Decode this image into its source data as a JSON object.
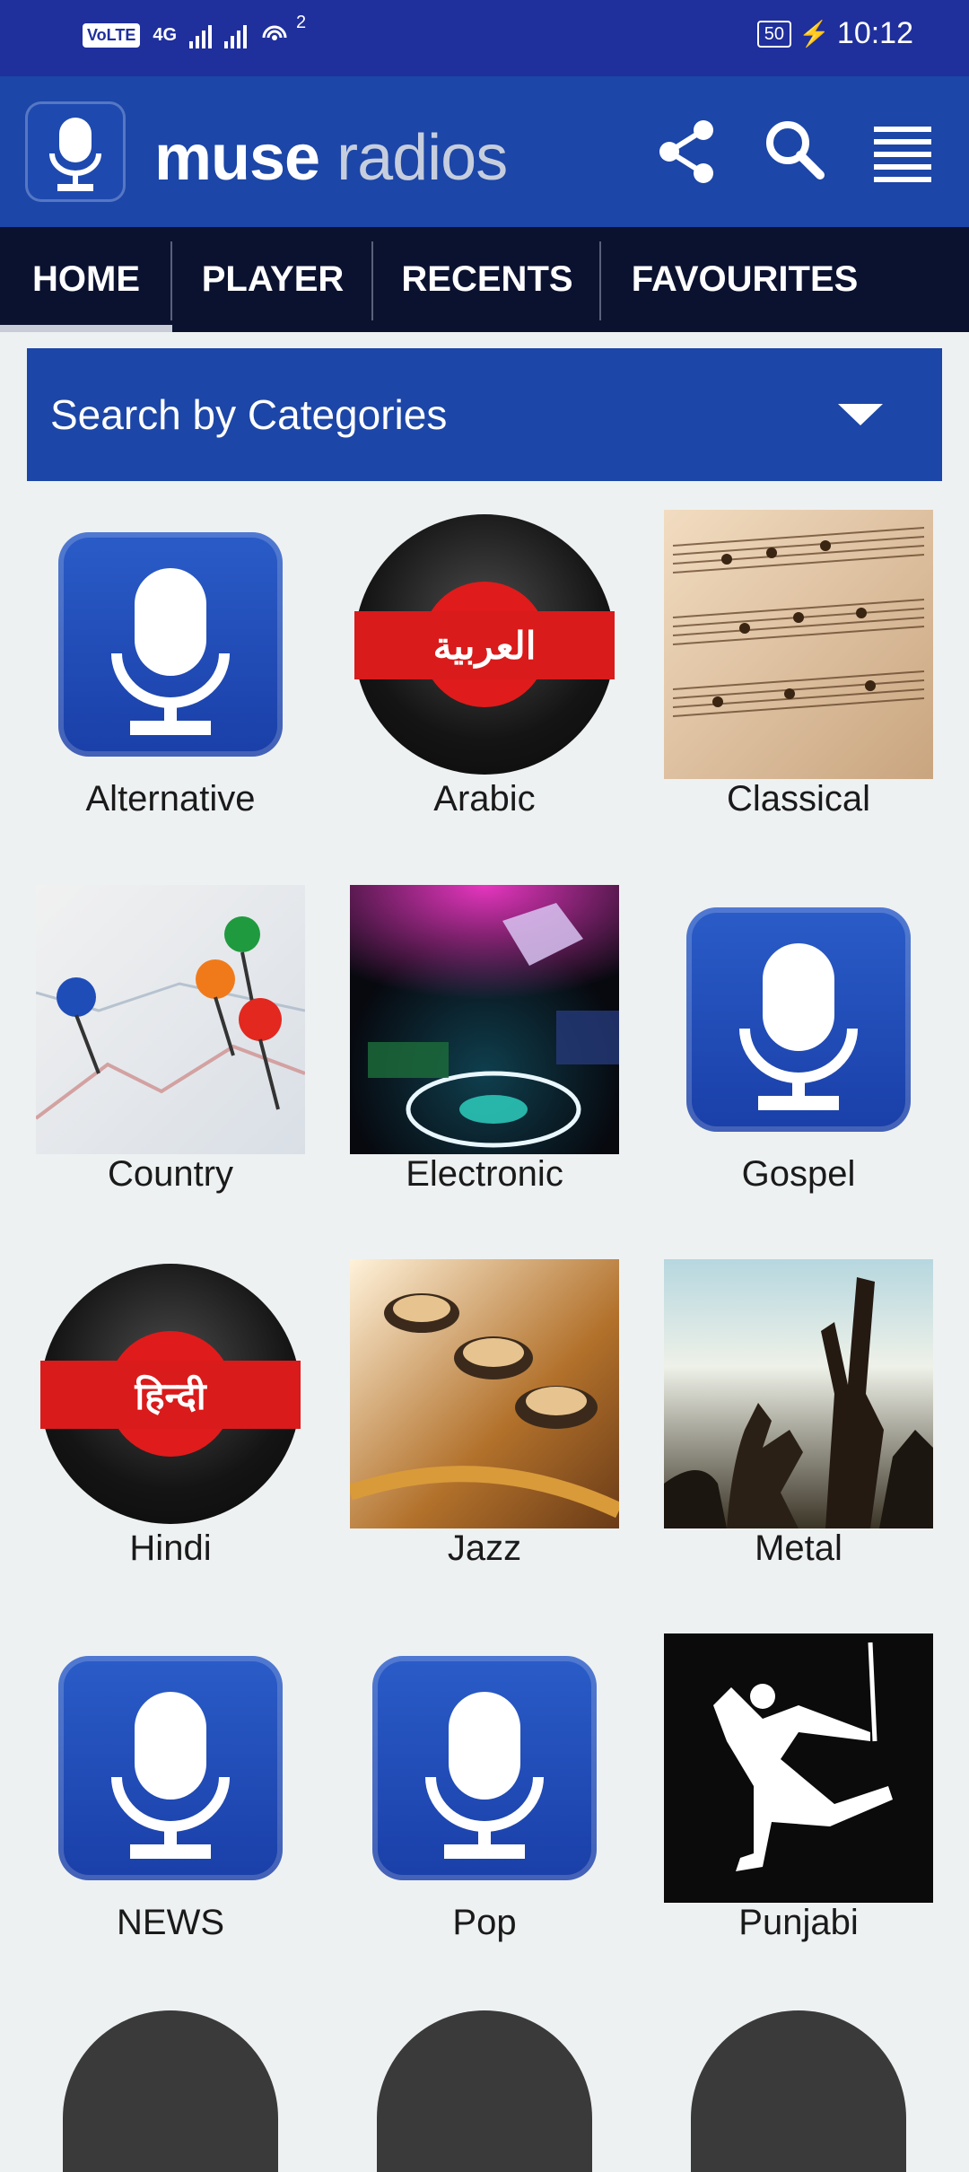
{
  "status": {
    "volte": "VoLTE",
    "net": "4G",
    "hotspot_count": "2",
    "battery": "50",
    "time": "10:12"
  },
  "app": {
    "title_part1": "muse",
    "title_part2": "radios",
    "icons": [
      "share-icon",
      "search-icon",
      "menu-icon"
    ]
  },
  "tabs": [
    {
      "label": "HOME",
      "active": true
    },
    {
      "label": "PLAYER",
      "active": false
    },
    {
      "label": "RECENTS",
      "active": false
    },
    {
      "label": "FAVOURITES",
      "active": false
    }
  ],
  "category_dropdown": {
    "label": "Search by Categories"
  },
  "categories": [
    {
      "label": "Alternative",
      "art": "mic-icon"
    },
    {
      "label": "Arabic",
      "art": "disc",
      "disc_text": "العربية"
    },
    {
      "label": "Classical",
      "art": "photo"
    },
    {
      "label": "Country",
      "art": "photo"
    },
    {
      "label": "Electronic",
      "art": "photo"
    },
    {
      "label": "Gospel",
      "art": "mic-icon"
    },
    {
      "label": "Hindi",
      "art": "disc",
      "disc_text": "हिन्दी"
    },
    {
      "label": "Jazz",
      "art": "photo"
    },
    {
      "label": "Metal",
      "art": "photo"
    },
    {
      "label": "NEWS",
      "art": "mic-icon"
    },
    {
      "label": "Pop",
      "art": "mic-icon"
    },
    {
      "label": "Punjabi",
      "art": "photo"
    }
  ],
  "colors": {
    "status_bar": "#1f2f9c",
    "app_bar": "#1c46a7",
    "tabs_bg": "#0b1230",
    "background": "#eef1f2"
  }
}
